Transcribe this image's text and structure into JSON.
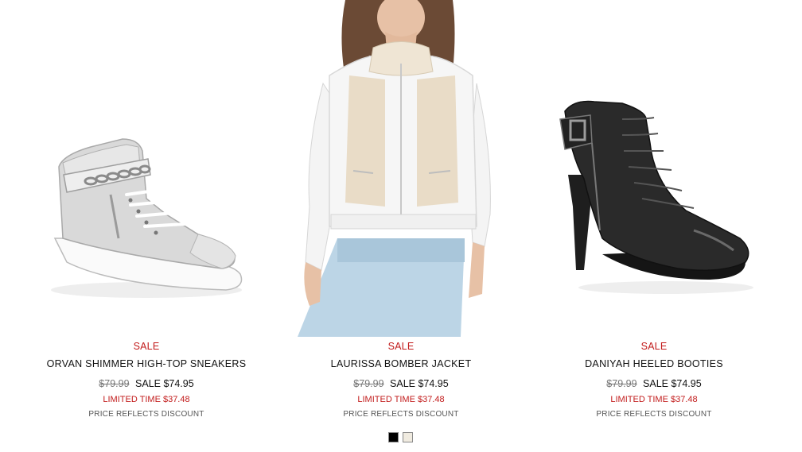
{
  "products": [
    {
      "image_alt": "orvan-shimmer-sneaker",
      "sale_tag": "SALE",
      "name": "ORVAN SHIMMER HIGH-TOP SNEAKERS",
      "original_price": "$79.99",
      "sale_price": "SALE $74.95",
      "limited": "LIMITED TIME $37.48",
      "note": "PRICE REFLECTS DISCOUNT"
    },
    {
      "image_alt": "laurissa-bomber-jacket",
      "sale_tag": "SALE",
      "name": "LAURISSA BOMBER JACKET",
      "original_price": "$79.99",
      "sale_price": "SALE $74.95",
      "limited": "LIMITED TIME $37.48",
      "note": "PRICE REFLECTS DISCOUNT"
    },
    {
      "image_alt": "daniyah-heeled-booties",
      "sale_tag": "SALE",
      "name": "DANIYAH HEELED BOOTIES",
      "original_price": "$79.99",
      "sale_price": "SALE $74.95",
      "limited": "LIMITED TIME $37.48",
      "note": "PRICE REFLECTS DISCOUNT"
    }
  ],
  "swatches": [
    {
      "color": "#000000"
    },
    {
      "color": "#f0ebe0"
    }
  ],
  "colors": {
    "sale_red": "#c21b1b"
  }
}
